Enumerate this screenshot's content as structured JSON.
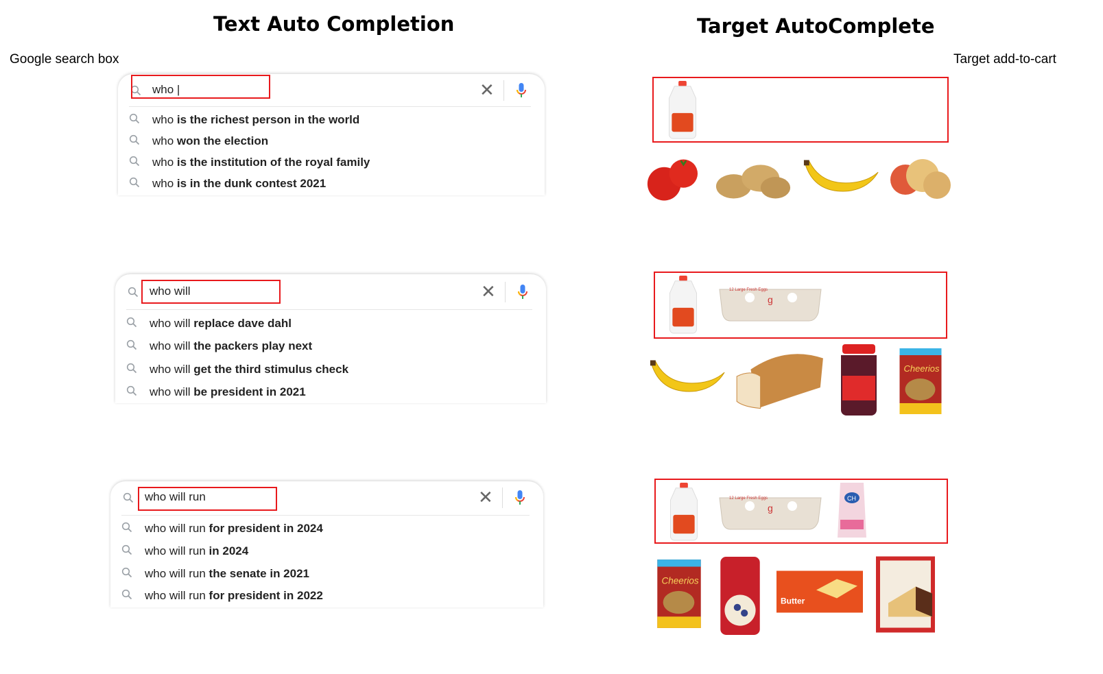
{
  "left_panel": {
    "title": "Text Auto Completion",
    "label": "Google search box",
    "search_boxes": [
      {
        "query": "who |",
        "typed": "who",
        "suggestions": [
          {
            "prefix": "who",
            "completion": " is the richest person in the world"
          },
          {
            "prefix": "who",
            "completion": " won the election"
          },
          {
            "prefix": "who",
            "completion": " is the institution of the royal family"
          },
          {
            "prefix": "who",
            "completion": " is in the dunk contest 2021"
          }
        ]
      },
      {
        "query": "who will",
        "typed": "who will",
        "suggestions": [
          {
            "prefix": "who will",
            "completion": " replace dave dahl"
          },
          {
            "prefix": "who will",
            "completion": " the packers play next"
          },
          {
            "prefix": "who will",
            "completion": " get the third stimulus check"
          },
          {
            "prefix": "who will",
            "completion": " be president in 2021"
          }
        ]
      },
      {
        "query": "who will run",
        "typed": "who will run",
        "suggestions": [
          {
            "prefix": "who will run",
            "completion": " for president in 2024"
          },
          {
            "prefix": "who will run",
            "completion": " in 2024"
          },
          {
            "prefix": "who will run",
            "completion": " the senate in 2021"
          },
          {
            "prefix": "who will run",
            "completion": " for president in 2022"
          }
        ]
      }
    ],
    "icons": {
      "search": "search-icon",
      "clear": "close-icon",
      "voice": "microphone-icon"
    }
  },
  "right_panel": {
    "title": "Target AutoComplete",
    "label": "Target add-to-cart",
    "rows": [
      {
        "cart": [
          "milk"
        ],
        "suggestions": [
          "tomatoes",
          "potatoes",
          "banana",
          "onions"
        ]
      },
      {
        "cart": [
          "milk",
          "eggs"
        ],
        "suggestions": [
          "banana",
          "bread",
          "strawberry-jam",
          "cheerios"
        ]
      },
      {
        "cart": [
          "milk",
          "eggs",
          "sugar"
        ],
        "suggestions": [
          "cheerios",
          "oats",
          "butter",
          "cake-mix"
        ]
      }
    ]
  },
  "colors": {
    "highlight_box": "#e8191c",
    "text": "#222222",
    "clear_icon": "#666666"
  }
}
